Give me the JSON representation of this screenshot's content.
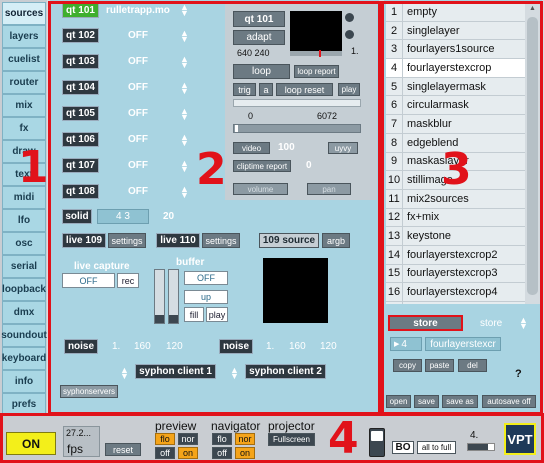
{
  "sidebar": {
    "tabs": [
      "sources",
      "layers",
      "cuelist",
      "router",
      "mix",
      "fx",
      "draw",
      "text",
      "midi",
      "lfo",
      "osc",
      "serial",
      "loopback",
      "dmx",
      "soundout",
      "keyboard",
      "info",
      "prefs"
    ]
  },
  "regions": {
    "one": "1",
    "two": "2",
    "three": "3",
    "four": "4"
  },
  "sources": {
    "qt_rows": [
      {
        "label": "qt 101",
        "value": "rulletrapp.mo"
      },
      {
        "label": "qt 102",
        "value": "OFF"
      },
      {
        "label": "qt 103",
        "value": "OFF"
      },
      {
        "label": "qt 104",
        "value": "OFF"
      },
      {
        "label": "qt 105",
        "value": "OFF"
      },
      {
        "label": "qt 106",
        "value": "OFF"
      },
      {
        "label": "qt 107",
        "value": "OFF"
      },
      {
        "label": "qt 108",
        "value": "OFF"
      }
    ],
    "help": "?",
    "player": {
      "qt_label": "qt 101",
      "adapt": "adapt",
      "size": "640 240",
      "one": "1.",
      "loop": "loop",
      "loop_report": "loop report",
      "trig": "trig",
      "a": "a",
      "loop_reset": "loop reset",
      "play": "play",
      "range_start": "0",
      "range_end": "6072",
      "video": "video",
      "video_value": "100",
      "uyvy": "uyvy",
      "cliptime_report": "cliptime report",
      "cliptime_value": "0",
      "volume": "volume",
      "pan": "pan"
    },
    "solid": {
      "label": "solid",
      "value1": "4 3",
      "value2": "20"
    },
    "live": [
      {
        "label": "live 109",
        "settings": "settings"
      },
      {
        "label": "live 110",
        "settings": "settings"
      }
    ],
    "source109": {
      "label": "109 source",
      "format": "argb"
    },
    "live_capture": {
      "label": "live capture",
      "state": "OFF",
      "rec": "rec"
    },
    "buffer": {
      "label": "buffer",
      "state": "OFF",
      "up": "up",
      "fill": "fill",
      "play": "play"
    },
    "noise1": {
      "label": "noise",
      "v1": "1.",
      "v2": "160",
      "v3": "120"
    },
    "noise2": {
      "label": "noise",
      "v1": "1.",
      "v2": "160",
      "v3": "120"
    },
    "syphon1": "syphon client 1",
    "syphon2": "syphon client 2",
    "syphonservers": "syphonservers"
  },
  "presets": {
    "items": [
      "empty",
      "singlelayer",
      "fourlayers1source",
      "fourlayerstexcrop",
      "singlelayermask",
      "circularmask",
      "maskblur",
      "edgeblend",
      "maskaslayer",
      "stillimage",
      "mix2sources",
      "fx+mix",
      "keystone",
      "fourlayerstexcrop2",
      "fourlayerstexcrop3",
      "fourlayerstexcrop4",
      "fourlayerstexcrop5"
    ],
    "selected_index": 3,
    "store": "store",
    "store_menu": "store",
    "current_num": "4",
    "current_name": "fourlayerstexcr",
    "copy": "copy",
    "paste": "paste",
    "del": "del",
    "help": "?",
    "open": "open",
    "save": "save",
    "save_as": "save as",
    "autosave": "autosave off"
  },
  "bottom": {
    "on": "ON",
    "fps_value": "27.2...",
    "fps": "fps",
    "reset": "reset",
    "preview": "preview",
    "navigator": "navigator",
    "projector": "projector",
    "flo": "flo",
    "nor": "nor",
    "off": "off",
    "on_small": "on",
    "fullscreen": "Fullscreen",
    "bo": "BO",
    "all_to_full": "all to full",
    "num": "4.",
    "logo": "VPT"
  },
  "colors": {
    "frame": "#e1121a",
    "panel": "#a9d4e2",
    "green": "#3faf2e",
    "onyellow": "#f3ef1a",
    "orange": "#f5a419"
  }
}
